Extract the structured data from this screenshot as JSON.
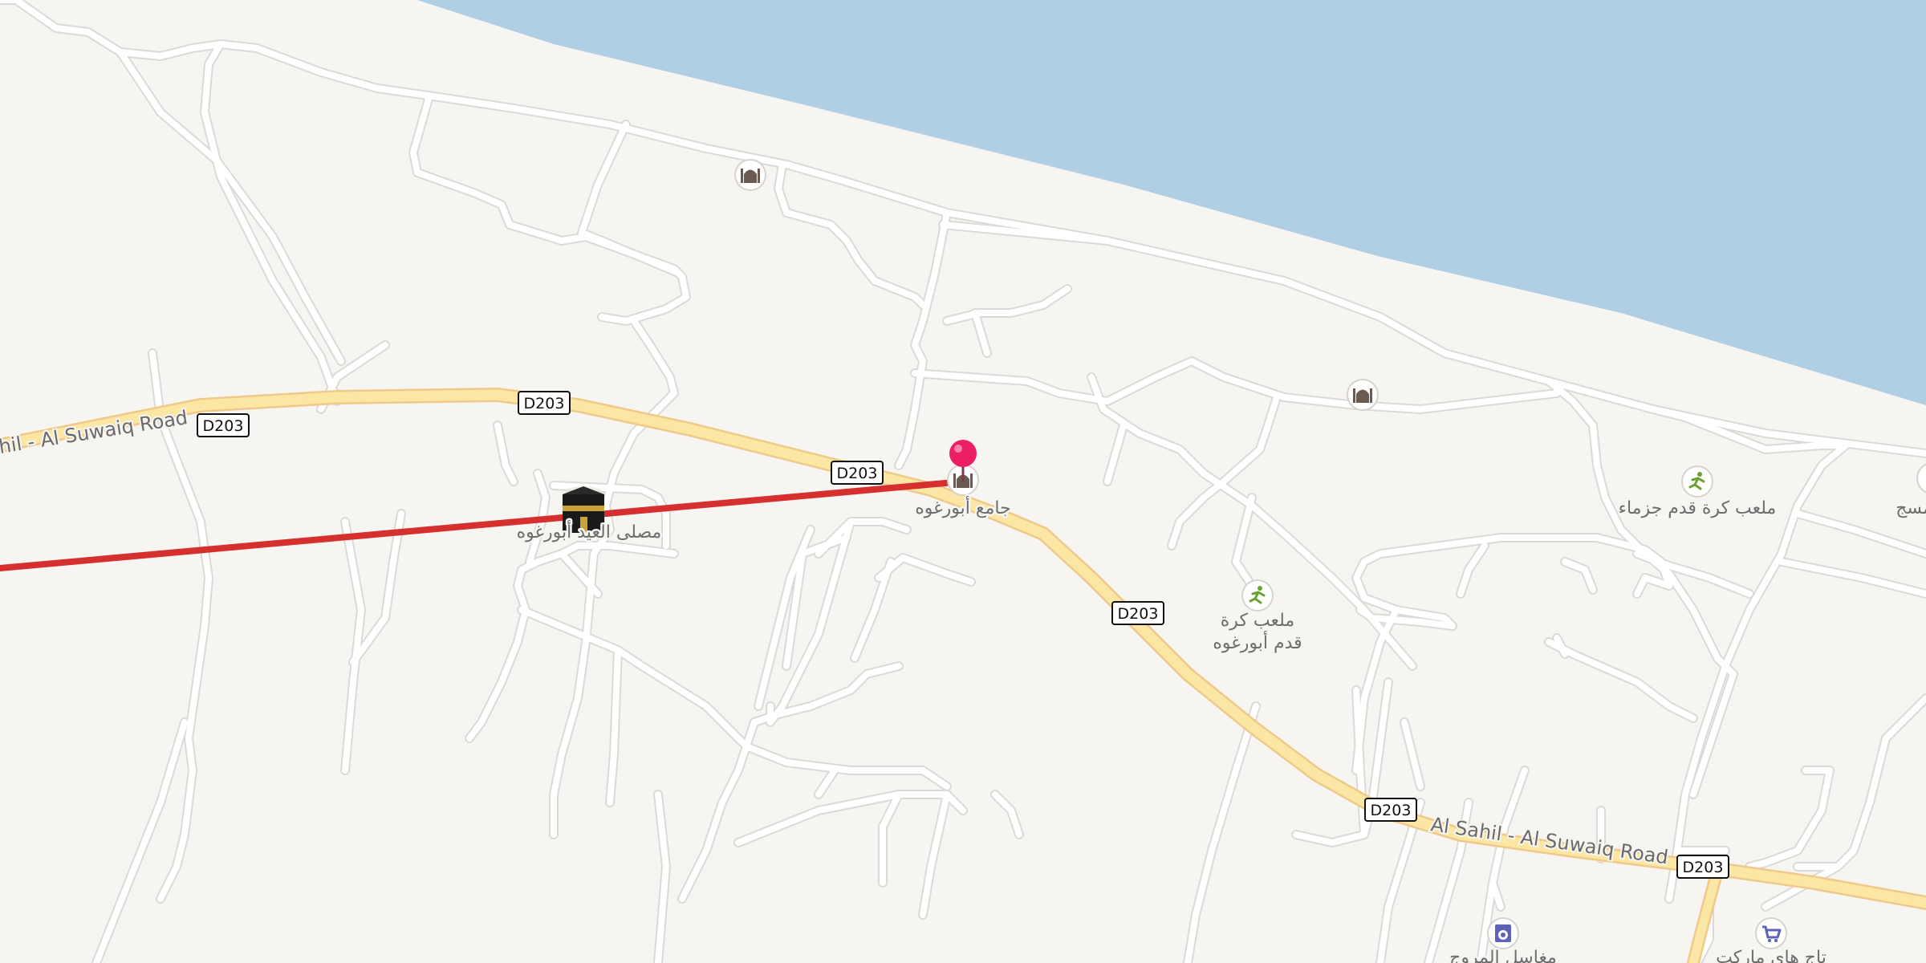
{
  "map": {
    "colors": {
      "land": "#f7f5f2",
      "water": "#b0cfe4",
      "minor_road": "#ffffff",
      "minor_road_casing": "#dcdad7",
      "primary_road": "#fce6a4",
      "primary_road_casing": "#efc98a",
      "route_line": "#d62f2f",
      "marker": "#ec1f64",
      "poi_amenity": "#6b5a52",
      "poi_leisure": "#6aa12f",
      "poi_shop": "#5c63b8"
    },
    "roads": {
      "primary_name": "Al Sahil - Al Suwaiq Road",
      "primary_name_partial": "hil - Al Suwaiq Road",
      "route_ref": "D203"
    },
    "pois": [
      {
        "id": "mosque-top",
        "icon": "mosque-icon",
        "label": ""
      },
      {
        "id": "mosque-east",
        "icon": "mosque-icon",
        "label": ""
      },
      {
        "id": "eid-prayer-ground",
        "icon": "kaaba-icon",
        "label": "مصلى العيد أبورغوه"
      },
      {
        "id": "main-mosque",
        "icon": "mosque-icon",
        "label": "جامع أبورغوه"
      },
      {
        "id": "football-jazma",
        "icon": "sports-pitch-icon",
        "label": "ملعب كرة قدم جزماء"
      },
      {
        "id": "football-aburghwa",
        "icon": "sports-pitch-icon",
        "label_line1": "ملعب كرة",
        "label_line2": "قدم أبورغوه"
      },
      {
        "id": "laundry",
        "icon": "laundry-icon",
        "label": "مغاسل المروج"
      },
      {
        "id": "supermarket",
        "icon": "supermarket-icon",
        "label": "تاج هاي ماركت"
      },
      {
        "id": "edge-poi",
        "icon": "poi-icon",
        "label": "مسج"
      }
    ],
    "marker": {
      "name": "location-pin"
    }
  }
}
